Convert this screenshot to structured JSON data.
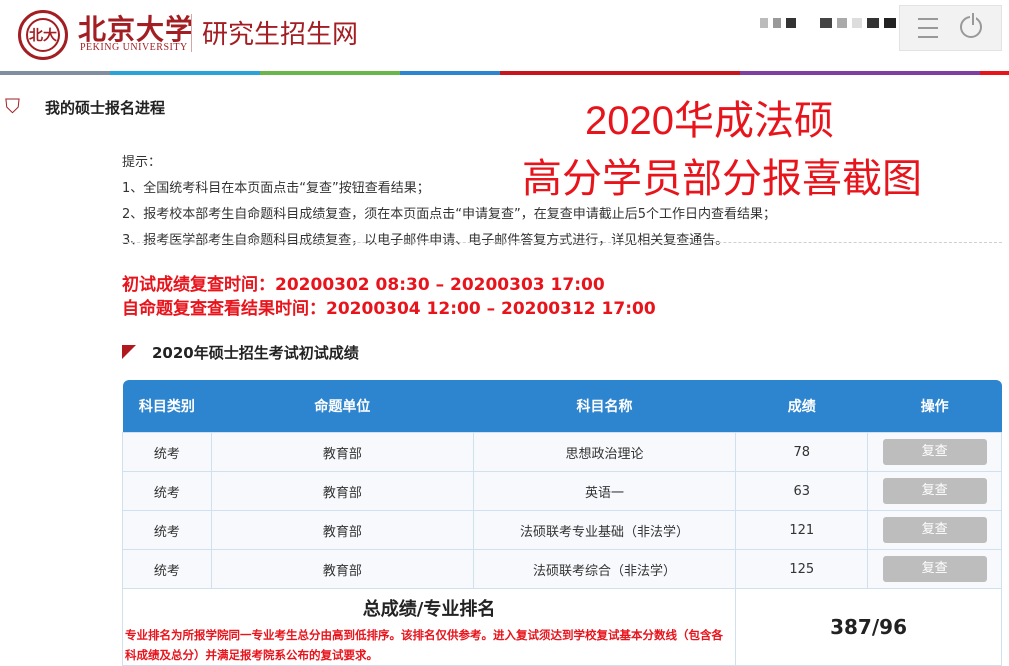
{
  "header": {
    "logo_cn": "北京大学",
    "logo_en": "PEKING UNIVERSITY",
    "site_title": "研究生招生网",
    "brand_color": "#a21e23"
  },
  "colorbar": [
    "#7f8f9f",
    "#2aa3d8",
    "#6ab64a",
    "#2d84cf",
    "#c8151b",
    "#7f3fa0",
    "#e8141c"
  ],
  "sidebar": {
    "section_title": "我的硕士报名进程"
  },
  "overlay": {
    "line1": "2020华成法硕",
    "line2": "高分学员部分报喜截图"
  },
  "tips": {
    "heading": "提示：",
    "items": [
      "1、全国统考科目在本页面点击“复查”按钮查看结果；",
      "2、报考校本部考生自命题科目成绩复查，须在本页面点击“申请复查”，在复查申请截止后5个工作日内查看结果；",
      "3、报考医学部考生自命题科目成绩复查，以电子邮件申请、电子邮件答复方式进行，详见相关复查通告。"
    ]
  },
  "times": {
    "line1": "初试成绩复查时间：20200302 08:30 – 20200303 17:00",
    "line2": "自命题复查查看结果时间：20200304 12:00 – 20200312 17:00"
  },
  "scores": {
    "title": "2020年硕士招生考试初试成绩",
    "headers": [
      "科目类别",
      "命题单位",
      "科目名称",
      "成绩",
      "操作"
    ],
    "rows": [
      {
        "category": "统考",
        "unit": "教育部",
        "subject": "思想政治理论",
        "score": "78",
        "action": "复查"
      },
      {
        "category": "统考",
        "unit": "教育部",
        "subject": "英语一",
        "score": "63",
        "action": "复查"
      },
      {
        "category": "统考",
        "unit": "教育部",
        "subject": "法硕联考专业基础（非法学）",
        "score": "121",
        "action": "复查"
      },
      {
        "category": "统考",
        "unit": "教育部",
        "subject": "法硕联考综合（非法学）",
        "score": "125",
        "action": "复查"
      }
    ],
    "total_title": "总成绩/专业排名",
    "total_note": "专业排名为所报学院同一专业考生总分由高到低排序。该排名仅供参考。进入复试须达到学校复试基本分数线（包含各科成绩及总分）并满足报考院系公布的复试要求。",
    "total_value": "387/96"
  }
}
